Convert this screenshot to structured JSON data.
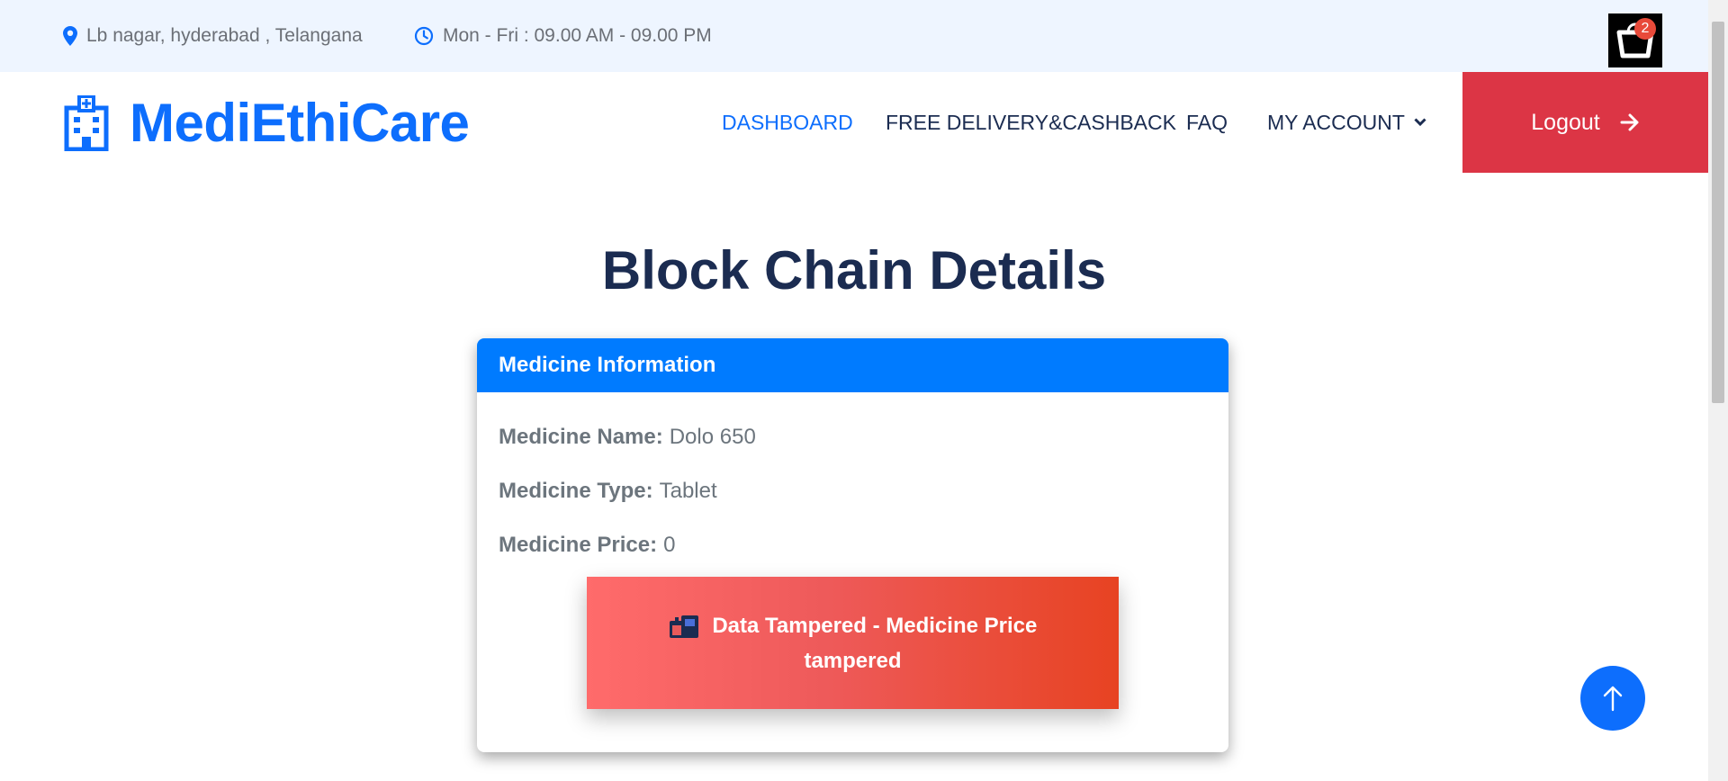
{
  "topbar": {
    "location": "Lb nagar, hyderabad , Telangana",
    "hours": "Mon - Fri : 09.00 AM - 09.00 PM",
    "cart_count": "2",
    "icons": [
      "map-marker-icon",
      "clock-icon",
      "shopping-bag-icon"
    ]
  },
  "brand": {
    "name": "MediEthiCare",
    "icon": "hospital-icon"
  },
  "nav": {
    "dashboard": "DASHBOARD",
    "delivery": "FREE DELIVERY&CASHBACK",
    "faq": "FAQ",
    "account": "MY ACCOUNT",
    "logout": "Logout"
  },
  "main": {
    "title": "Block Chain Details",
    "card": {
      "header": "Medicine Information",
      "fields": [
        {
          "label": "Medicine Name:",
          "value": "Dolo 650"
        },
        {
          "label": "Medicine Type:",
          "value": "Tablet"
        },
        {
          "label": "Medicine Price:",
          "value": "0"
        }
      ],
      "alert": "Data Tampered - Medicine Price tampered"
    }
  },
  "colors": {
    "primary": "#0d6efd",
    "logout": "#dc3545",
    "card_header": "#007bff",
    "alert_start": "#ff6b6b",
    "alert_end": "#e74322",
    "topbar_bg": "#eef5ff"
  }
}
